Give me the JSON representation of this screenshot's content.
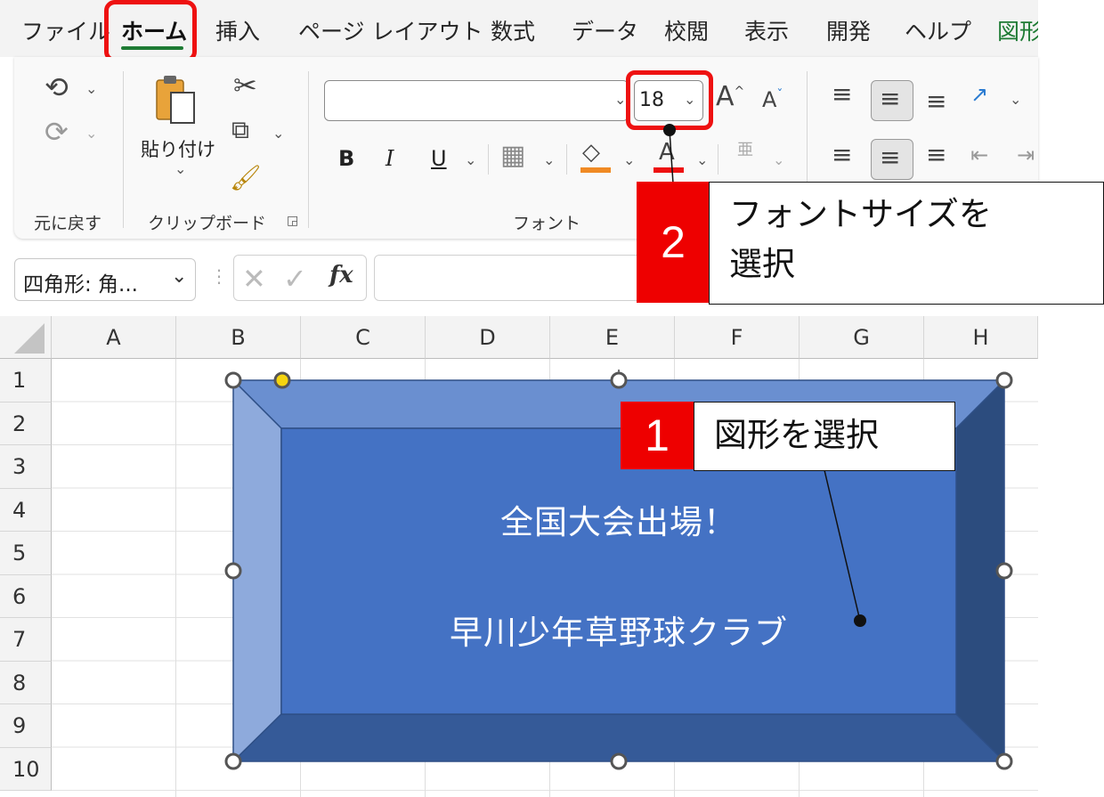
{
  "ribbon": {
    "tabs": [
      "ファイル",
      "ホーム",
      "挿入",
      "ページ レイアウト",
      "数式",
      "データ",
      "校閲",
      "表示",
      "開発",
      "ヘルプ",
      "図形"
    ],
    "groups": {
      "undo_label": "元に戻す",
      "clipboard_label": "クリップボード",
      "clipboard_paste_label": "貼り付け",
      "font_label": "フォント"
    },
    "font": {
      "name_value": "",
      "size_value": "18",
      "bold": "B",
      "italic": "I",
      "underline": "U"
    }
  },
  "formula_bar": {
    "name_box_value": "四角形: 角...",
    "fx_label": "fx",
    "formula_value": ""
  },
  "sheet": {
    "columns": [
      "A",
      "B",
      "C",
      "D",
      "E",
      "F",
      "G",
      "H"
    ],
    "rows": [
      "1",
      "2",
      "3",
      "4",
      "5",
      "6",
      "7",
      "8",
      "9",
      "10"
    ]
  },
  "shape": {
    "line1": "全国大会出場！",
    "line2": "早川少年草野球クラブ",
    "colors": {
      "face": "#4472c4",
      "top": "#6a8fd0",
      "left": "#8eaadc",
      "right": "#2c4c7e",
      "bottom": "#355a98"
    }
  },
  "annotations": {
    "step1": {
      "number": "1",
      "text": "図形を選択"
    },
    "step2": {
      "number": "2",
      "text_line1": "フォントサイズを",
      "text_line2": "選択"
    },
    "highlight_color": "#ee1111"
  }
}
